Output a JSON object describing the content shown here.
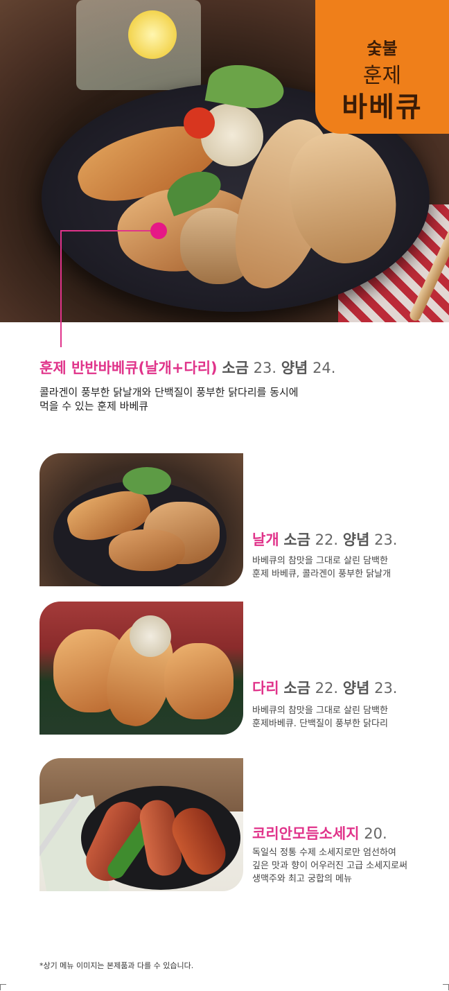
{
  "badge": {
    "line1": "숯불",
    "line2": "훈제",
    "line3": "바베큐"
  },
  "colors": {
    "accent_pink": "#e0338a",
    "badge_orange": "#ef7f1a",
    "text_grey": "#555555"
  },
  "main_item": {
    "name": "훈제 반반바베큐(날개+다리)",
    "salt_label": "소금",
    "salt_price": "23.",
    "sauce_label": "양념",
    "sauce_price": "24.",
    "desc_line1": "콜라겐이 풍부한 닭날개와 단백질이 풍부한 닭다리를 동시에",
    "desc_line2": "먹을 수 있는 훈제 바베큐"
  },
  "items": [
    {
      "name": "날개",
      "salt_label": "소금",
      "salt_price": "22.",
      "sauce_label": "양념",
      "sauce_price": "23.",
      "desc_line1": "바베큐의 참맛을 그대로 살린 담백한",
      "desc_line2": "훈제 바베큐, 콜라겐이 풍부한 닭날개"
    },
    {
      "name": "다리",
      "salt_label": "소금",
      "salt_price": "22.",
      "sauce_label": "양념",
      "sauce_price": "23.",
      "desc_line1": "바베큐의 참맛을 그대로 살린 담백한",
      "desc_line2": "훈제바베큐. 단백질이 풍부한 닭다리"
    },
    {
      "name": "코리안모듬소세지",
      "price": "20.",
      "desc_line1": "독일식 정통 수제 소세지로만 엄선하여",
      "desc_line2": "깊은 맛과 향이 어우러진 고급 소세지로써",
      "desc_line3": "생맥주와 최고 궁합의 메뉴"
    }
  ],
  "footnote": "*상기 메뉴 이미지는 본제품과 다를 수 있습니다."
}
